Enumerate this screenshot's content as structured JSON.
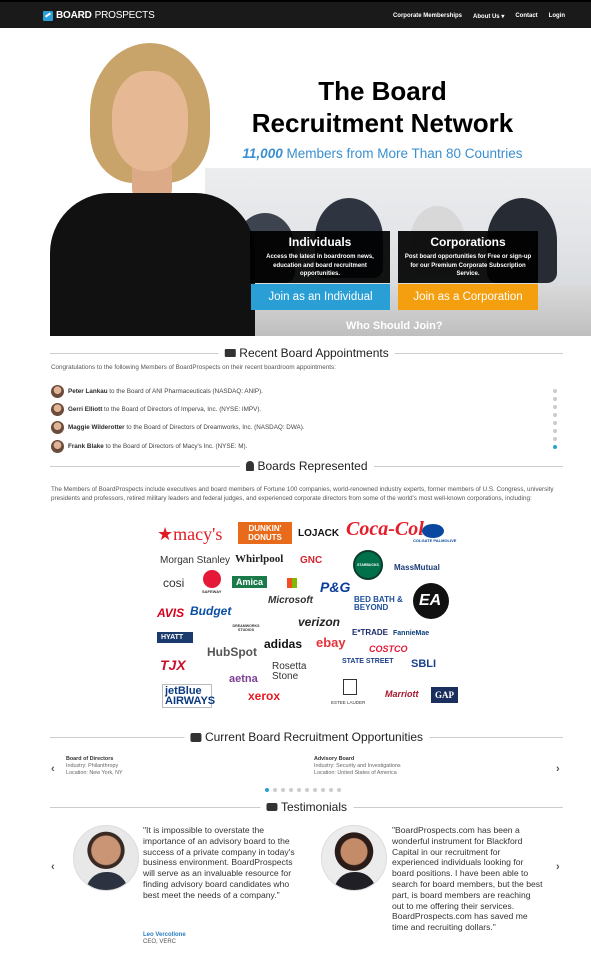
{
  "nav": {
    "brand_bold": "BOARD",
    "brand_rest": "PROSPECTS",
    "links": [
      "Corporate Memberships",
      "About Us ▾",
      "Contact",
      "Login"
    ]
  },
  "hero": {
    "title_line1": "The Board",
    "title_line2": "Recruitment Network",
    "sub_number": "11,000",
    "sub_rest": " Members from More Than 80 Countries",
    "individuals": {
      "title": "Individuals",
      "desc": "Access the latest in boardroom news, education and board recruitment opportunities.",
      "button": "Join as an Individual"
    },
    "corporations": {
      "title": "Corporations",
      "desc": "Post board opportunities for Free or sign-up for our Premium Corporate Subscription Service.",
      "button": "Join as a Corporation"
    },
    "who": "Who Should Join?"
  },
  "appointments": {
    "heading": "Recent Board Appointments",
    "intro": "Congratulations to the following Members of BoardProspects on their recent boardroom appointments:",
    "items": [
      {
        "name": "Peter Lankau",
        "text": " to the Board of ANI Pharmaceuticals (NASDAQ: ANIP)."
      },
      {
        "name": "Gerri Elliott",
        "text": " to the Board of Directors of Imperva, Inc. (NYSE: IMPV)."
      },
      {
        "name": "Maggie Wilderotter",
        "text": " to the Board of Directors of Dreamworks, Inc. (NASDAQ: DWA)."
      },
      {
        "name": "Frank Blake",
        "text": " to the Board of Directors of Macy's Inc. (NYSE: M)."
      }
    ]
  },
  "boards": {
    "heading": "Boards Represented",
    "text": "The Members of BoardProspects include executives and board members of Fortune 100 companies, world-renowned industry experts, former members of U.S. Congress, university presidents and professors, retired military leaders and federal judges, and experienced corporate directors from some of the world's most well-known corporations, including:",
    "logos": [
      "★macy's",
      "DUNKIN' DONUTS",
      "LOJACK",
      "Coca-Cola",
      "COLGATE PALMOLIVE",
      "Morgan Stanley",
      "Whirlpool",
      "GNC",
      "STARBUCKS",
      "MassMutual",
      "cosi",
      "SAFEWAY",
      "Amica",
      "Microsoft",
      "P&G",
      "BED BATH & BEYOND",
      "EA",
      "AVIS",
      "Budget",
      "DREAMWORKS STUDIOS",
      "verizon",
      "E*TRADE",
      "FannieMae",
      "HYATT",
      "HubSpot",
      "adidas",
      "ebay",
      "COSTCO",
      "TJX",
      "Rosetta Stone",
      "STATE STREET",
      "SBLI",
      "jetBlue AIRWAYS",
      "aetna",
      "xerox",
      "ESTEE LAUDER",
      "Marriott",
      "GAP"
    ]
  },
  "opportunities": {
    "heading": "Current Board Recruitment Opportunities",
    "items": [
      {
        "title": "Board of Directors",
        "industry": "Industry: Philanthropy",
        "location": "Location: New York, NY"
      },
      {
        "title": "Advisory Board",
        "industry": "Industry: Security and Investigations",
        "location": "Location: United States of America"
      }
    ]
  },
  "testimonials": {
    "heading": "Testimonials",
    "items": [
      {
        "quote": "\"It is impossible to overstate the importance of an advisory board to the success of a private company in today's business environment. BoardProspects will serve as an invaluable resource for finding advisory board candidates who best meet the needs of a company.\"",
        "name": "Leo Vercollone",
        "role": "CEO, VERC"
      },
      {
        "quote": "\"BoardProspects.com has been a wonderful instrument for Blackford Capital in our recruitment for experienced individuals looking for board positions. I have been able to search for board members, but the best part, is board members are reaching out to me offering their services. BoardProspects.com has saved me time and recruiting dollars.\"",
        "name": "",
        "role": ""
      }
    ]
  },
  "colors": {
    "accent": "#2a9fd6",
    "orange": "#f49f10",
    "nav": "#1a1a1a"
  }
}
